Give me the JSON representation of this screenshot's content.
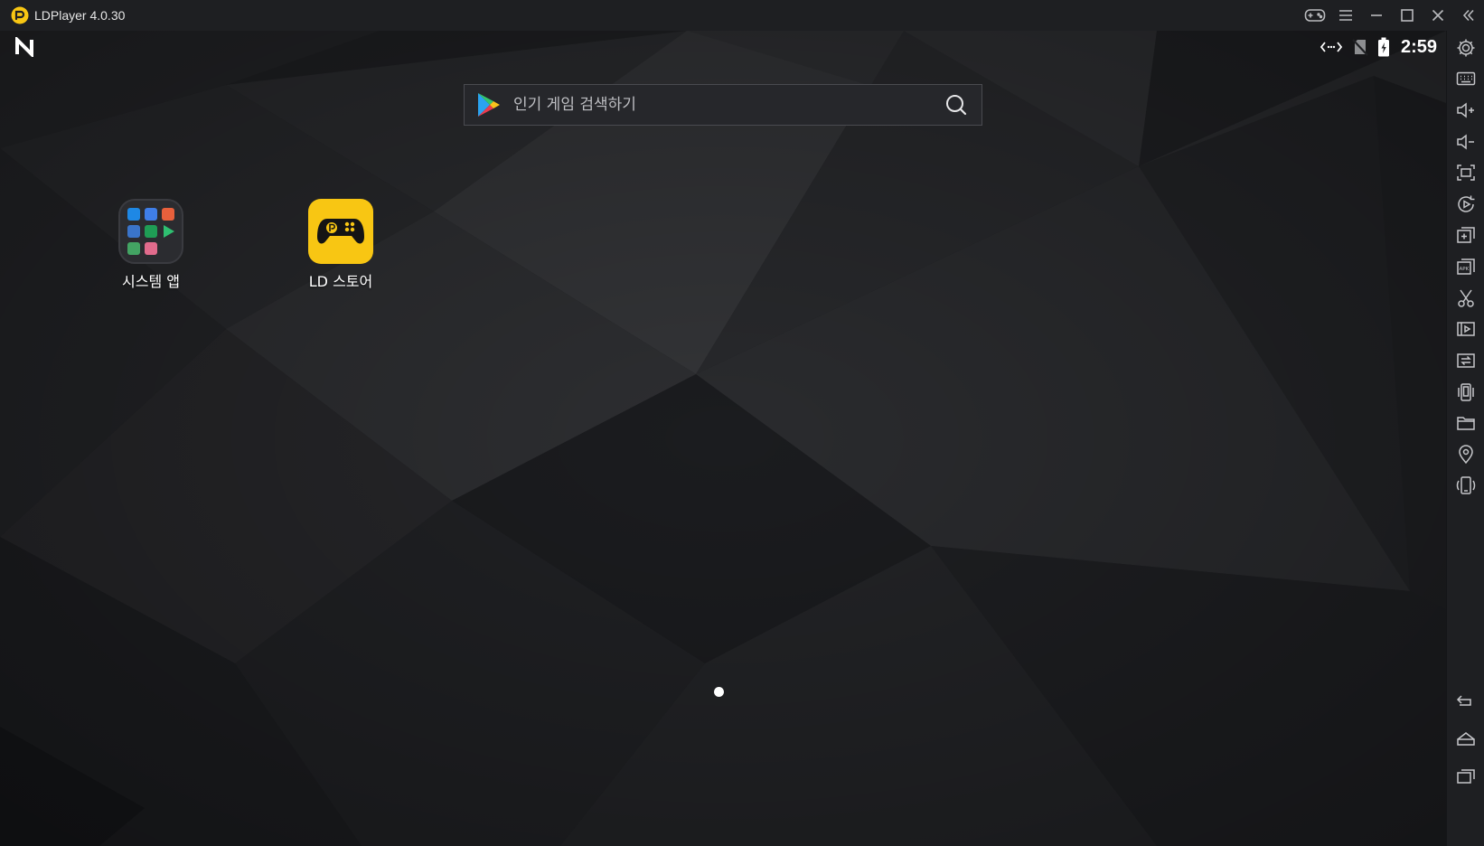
{
  "window": {
    "title": "LDPlayer 4.0.30",
    "accent_color": "#f8c613"
  },
  "status_bar": {
    "time": "2:59"
  },
  "search": {
    "placeholder": "인기 게임 검색하기"
  },
  "desktop": {
    "icons": [
      {
        "label": "시스템 앱"
      },
      {
        "label": "LD 스토어"
      }
    ]
  },
  "title_controls": [
    "gamepad-icon",
    "menu-icon",
    "minimize-icon",
    "maximize-icon",
    "close-icon",
    "collapse-sidebar-icon"
  ],
  "sidebar_tools": [
    "settings-icon",
    "keyboard-mapping-icon",
    "volume-up-icon",
    "volume-down-icon",
    "fullscreen-icon",
    "operation-record-icon",
    "multi-instance-icon",
    "install-apk-icon",
    "screenshot-scissors-icon",
    "video-record-icon",
    "sync-icon",
    "shake-icon",
    "shared-folder-icon",
    "location-icon",
    "rotate-icon",
    "back-icon",
    "home-icon",
    "recent-apps-icon"
  ]
}
